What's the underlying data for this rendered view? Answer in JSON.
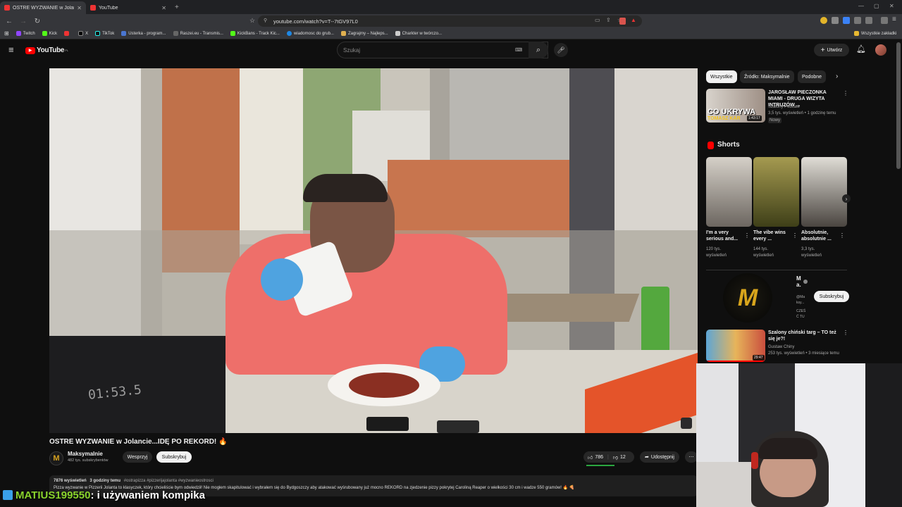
{
  "browser": {
    "tabs": [
      {
        "label": "OSTRE WYZWANIE w Jolancie",
        "active": true
      },
      {
        "label": "YouTube",
        "active": false
      }
    ],
    "url": "youtube.com/watch?v=T--7tGV97L0",
    "bookmarks": [
      "Twitch",
      "Kick",
      "X",
      "TikTok",
      "Usterka - program...",
      "Raszei.eu - Transmis...",
      "KickBans - Track Kic...",
      "wiadomosc do grub...",
      "Zagrajmy – Najleps...",
      "Charkter w twórczo..."
    ],
    "bookmarks_folder": "Wszystkie zakładki"
  },
  "youtube": {
    "logo_text": "YouTube",
    "logo_sup": "PL",
    "search_placeholder": "Szukaj",
    "create_label": "Utwórz"
  },
  "video": {
    "timer_overlay": "01:53.5",
    "title": "OSTRE WYZWANIE w Jolancie...IDĘ PO REKORD! 🔥",
    "channel_name": "Maksymalnie",
    "subscribers": "482 tys. subskrybentów",
    "support_label": "Wesprzyj",
    "subscribe_label": "Subskrybuj",
    "likes": "786",
    "dislikes": "12",
    "share_label": "Udostępnij",
    "views": "7876 wyświetleń",
    "age": "3 godziny temu",
    "hashtags": "#ostrapizza #pizzerijajolanta #wyzwanieostrosci",
    "description": "Pizza wyzwanie w Pizzerii Jolanta to klasyczek, który chcieliście bym odwiedził! Nie mogłem skapitulować i wybrałem się do Bydgoszczy aby atakować wyśrubowany już mocno REKORD na zjedzenie pizzy pokrytej Caroliną Reaper o wielkości 30 cm i wadze 550 gramów! 🔥 🍕"
  },
  "chat": {
    "username": "MATIUS199550",
    "message": ": i używaniem kompika"
  },
  "sidebar": {
    "chips": [
      "Wszystkie",
      "Źródło: Maksymalnie",
      "Podobne"
    ],
    "top_video": {
      "title": "JAROSŁAW PIECZONKA MIAMI - DRUGA WIZYTA INTRUZÓW ...",
      "channel": "Szalony Podcast",
      "meta": "3,5 tys. wyświetleń • 1 godzinę temu",
      "badge": "Nowy",
      "thumb_text1": "CO UKRYWA",
      "thumb_text2": "TOMASZ KAR",
      "duration": "1:43:17"
    },
    "shorts_label": "Shorts",
    "shorts": [
      {
        "title": "I'm a very serious and...",
        "views": "120 tys. wyświetleń"
      },
      {
        "title": "The vibe wins every ...",
        "views": "144 tys. wyświetleń"
      },
      {
        "title": "Absolutnie, absolutnie ...",
        "views": "3,3 tys. wyświetleń"
      }
    ],
    "channel_card": {
      "name": "M a.",
      "handle": "@Ma ksy...",
      "desc": "CZEŚ Ć TU",
      "subscribe_label": "Subskrybuj"
    },
    "bottom_video": {
      "title": "Szalony chiński targ – TO też się je?!",
      "channel": "Gustaw Chiny",
      "meta": "253 tys. wyświetleń • 3 miesiące temu",
      "duration": "29:47"
    }
  }
}
